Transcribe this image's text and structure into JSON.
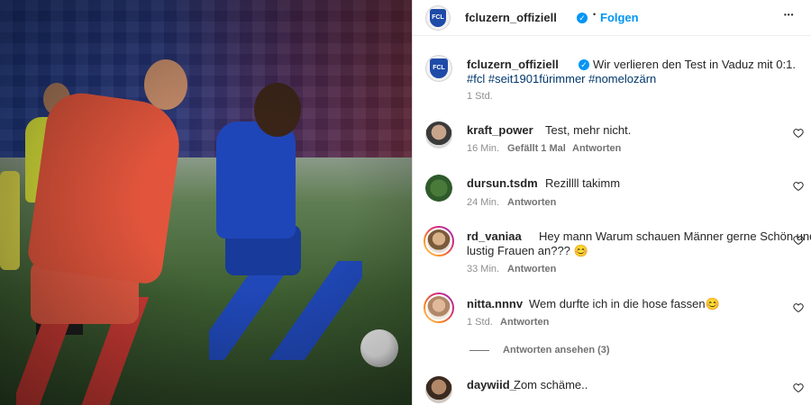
{
  "post": {
    "username": "fcluzern_offiziell",
    "follow_label": "Folgen",
    "dot": "•",
    "more_label": "•••",
    "caption": "Wir verlieren den Test in Vaduz mit 0:1.",
    "hashtags": "#fcl #seit1901fürimmer #nomelozärn",
    "time": "1 Std.",
    "logo_text": "FCL"
  },
  "comments": [
    {
      "user": "kraft_power",
      "text": "Test, mehr nicht.",
      "time": "16 Min.",
      "likes": "Gefällt 1 Mal",
      "reply": "Antworten"
    },
    {
      "user": "dursun.tsdm",
      "text": "Rezillll takimm",
      "time": "24 Min.",
      "reply": "Antworten"
    },
    {
      "user": "rd_vaniaa",
      "text_line1": "Hey mann Warum schauen Männer gerne Schön und",
      "text_line2": "lustig Frauen an??? 😊",
      "time": "33 Min.",
      "reply": "Antworten"
    },
    {
      "user": "nitta.nnnv",
      "text": "Wem durfte ich in die hose fassen😊",
      "time": "1 Std.",
      "reply": "Antworten"
    },
    {
      "user": "daywiid_",
      "text": "Zom schäme.."
    }
  ],
  "view_replies": "Antworten ansehen (3)",
  "colors": {
    "link_blue": "#0095f6",
    "hashtag": "#00376b",
    "verified": "#0095f6"
  }
}
